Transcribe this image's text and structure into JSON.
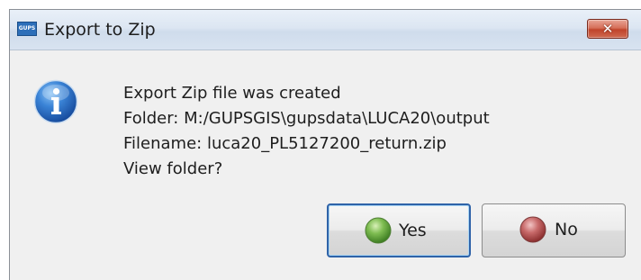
{
  "window": {
    "title": "Export to Zip",
    "app_icon_text": "GUPS",
    "close_glyph": "✕"
  },
  "icon": {
    "type": "information-icon",
    "glyph": "i"
  },
  "message": {
    "line1": "Export Zip file was created",
    "line2": "Folder: M:/GUPSGIS\\gupsdata\\LUCA20\\output",
    "line3": "Filename: luca20_PL5127200_return.zip",
    "line4": "View folder?"
  },
  "buttons": {
    "yes_label": "Yes",
    "no_label": "No"
  },
  "colors": {
    "accent_border": "#2f63a8",
    "close_red": "#c0442b",
    "yes_orb": "#5fa83c",
    "no_orb": "#b84a4a",
    "info_blue": "#1f5fb8"
  }
}
